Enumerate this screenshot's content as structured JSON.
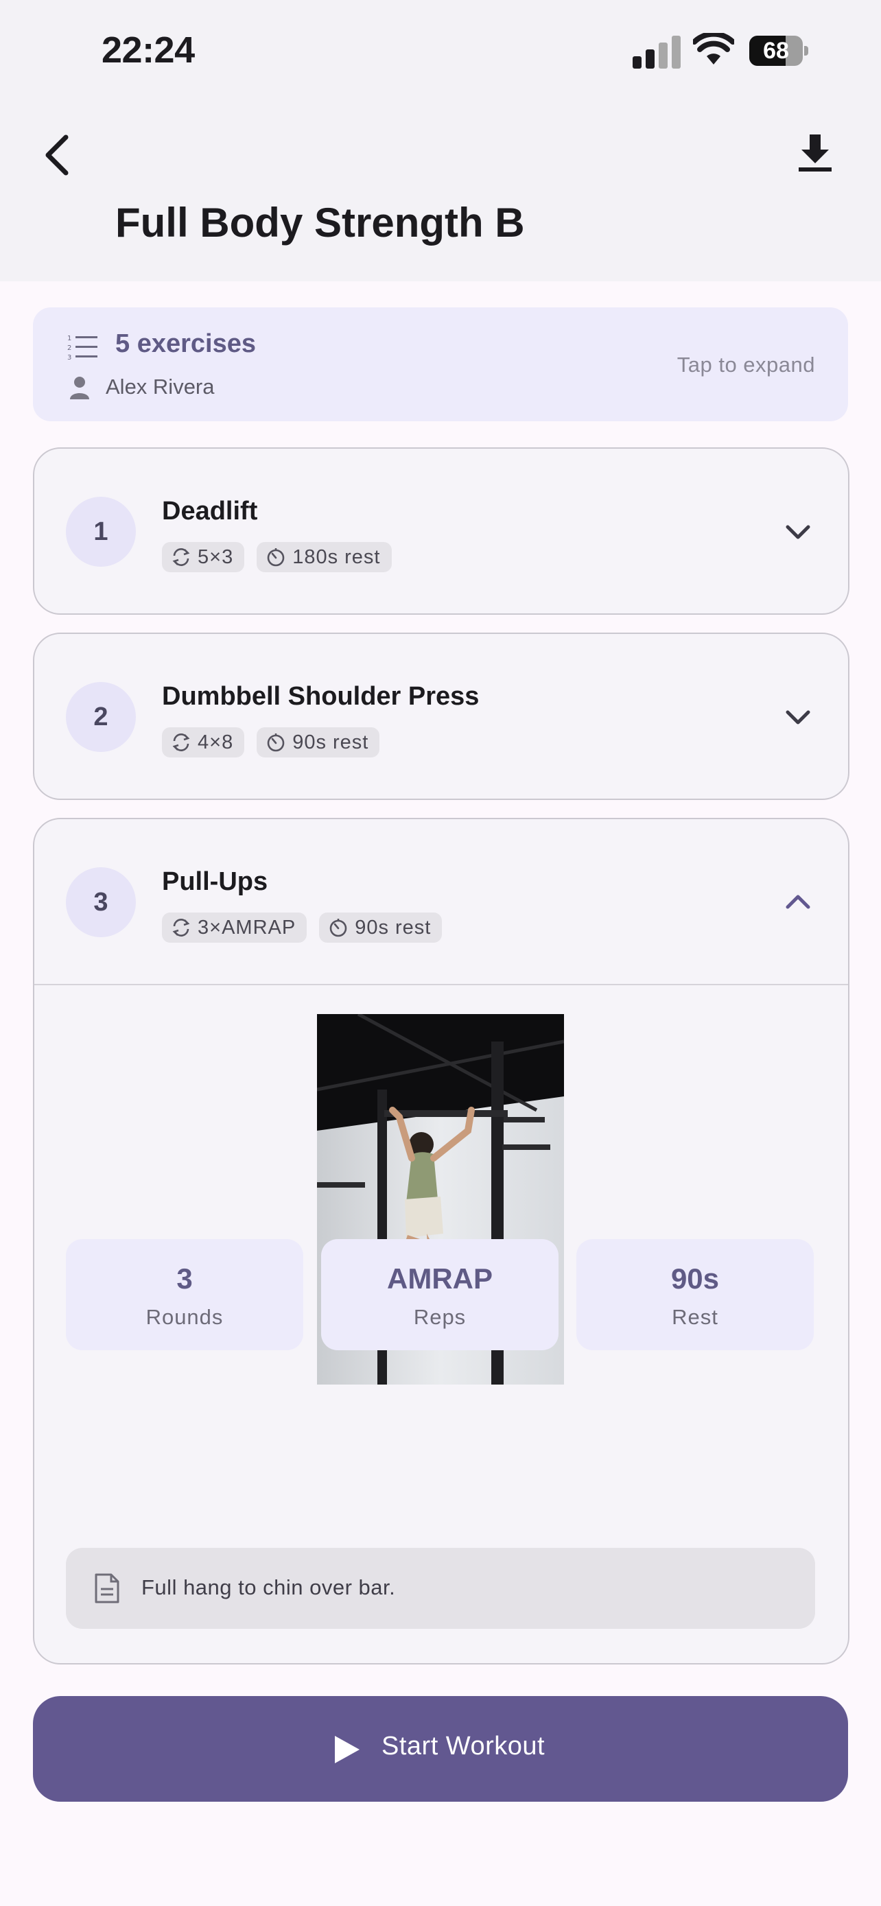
{
  "status_bar": {
    "time": "22:24",
    "battery": "68",
    "battery_level": 0.68
  },
  "header": {
    "title": "Full Body Strength B",
    "back_icon": "chevron-left-icon",
    "download_icon": "download-icon"
  },
  "summary": {
    "count_label": "5 exercises",
    "author": "Alex Rivera",
    "hint": "Tap to expand"
  },
  "exercises": [
    {
      "number": "1",
      "name": "Deadlift",
      "sets_reps": "5×3",
      "rest": "180s rest",
      "expanded": false
    },
    {
      "number": "2",
      "name": "Dumbbell Shoulder Press",
      "sets_reps": "4×8",
      "rest": "90s rest",
      "expanded": false
    },
    {
      "number": "3",
      "name": "Pull-Ups",
      "sets_reps": "3×AMRAP",
      "rest": "90s rest",
      "expanded": true,
      "details": {
        "stats": [
          {
            "value": "3",
            "label": "Rounds"
          },
          {
            "value": "AMRAP",
            "label": "Reps"
          },
          {
            "value": "90s",
            "label": "Rest"
          }
        ],
        "note": "Full hang to chin over bar."
      }
    }
  ],
  "start_button": {
    "label": "Start Workout"
  },
  "colors": {
    "accent": "#625890",
    "accent_light": "#edebfb",
    "header_bg": "#f3f2f6"
  }
}
